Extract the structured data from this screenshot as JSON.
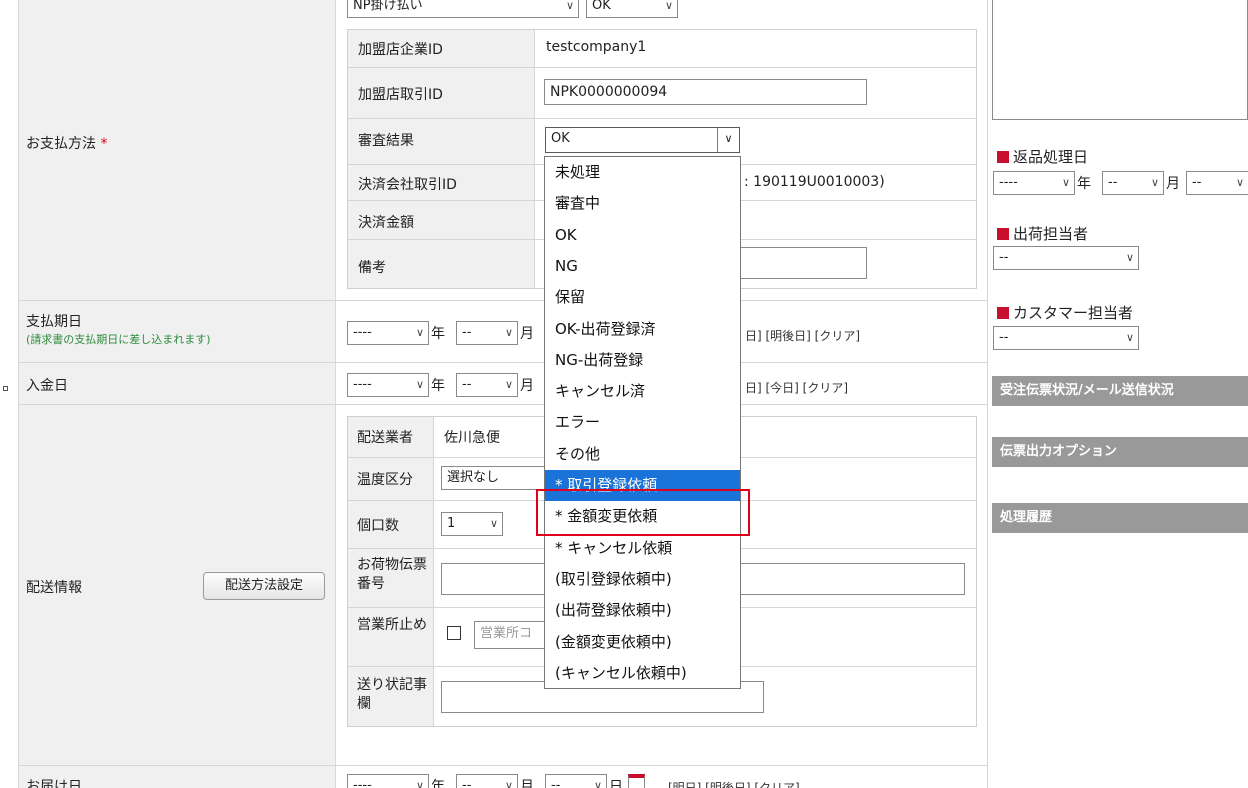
{
  "payment": {
    "label": "お支払方法",
    "required_mark": "*",
    "method_value": "NP掛け払い",
    "status_value": "OK",
    "rows": {
      "merchant_company_id_label": "加盟店企業ID",
      "merchant_company_id_value": "testcompany1",
      "merchant_txn_id_label": "加盟店取引ID",
      "merchant_txn_id_value": "NPK0000000094",
      "review_result_label": "審査結果",
      "review_result_value": "OK",
      "settlement_txn_id_label": "決済会社取引ID",
      "settlement_txn_id_partial": ": 190119U0010003)",
      "settlement_amount_label": "決済金額",
      "notes_label": "備考"
    }
  },
  "dropdown": {
    "options": [
      "未処理",
      "審査中",
      "OK",
      "NG",
      "保留",
      "OK-出荷登録済",
      "NG-出荷登録",
      "キャンセル済",
      "エラー",
      "その他",
      "* 取引登録依頼",
      "* 金額変更依頼",
      "* キャンセル依頼",
      "(取引登録依頼中)",
      "(出荷登録依頼中)",
      "(金額変更依頼中)",
      "(キャンセル依頼中)"
    ],
    "highlighted_index": 10,
    "boxed_index": 11
  },
  "due_date": {
    "label": "支払期日",
    "note": "(請求書の支払期日に差し込まれます)",
    "year": "----",
    "month": "--",
    "year_unit": "年",
    "month_unit": "月",
    "links": "日] [明後日] [クリア]"
  },
  "deposit_date": {
    "label": "入金日",
    "year": "----",
    "month": "--",
    "year_unit": "年",
    "month_unit": "月",
    "links": "日] [今日] [クリア]"
  },
  "shipping": {
    "label": "配送情報",
    "settings_button": "配送方法設定",
    "carrier_label": "配送業者",
    "carrier_value": "佐川急便",
    "temp_label": "温度区分",
    "temp_value": "選択なし",
    "count_label": "個口数",
    "count_value": "1",
    "tracking_label": "お荷物伝票番号",
    "office_hold_label": "営業所止め",
    "office_placeholder": "営業所コ",
    "remarks_label": "送り状記事欄"
  },
  "delivery_date": {
    "label": "お届け日",
    "year": "----",
    "month": "--",
    "day": "--",
    "year_unit": "年",
    "month_unit": "月",
    "day_unit": "日",
    "links": "[明日] [明後日] [クリア]"
  },
  "right_panel": {
    "return_date_label": "返品処理日",
    "return_year": "----",
    "return_month": "--",
    "return_day": "--",
    "year_unit": "年",
    "month_unit": "月",
    "shipper_label": "出荷担当者",
    "shipper_value": "--",
    "cs_label": "カスタマー担当者",
    "cs_value": "--",
    "section_order_status": "受注伝票状況/メール送信状況",
    "section_slip_options": "伝票出力オプション",
    "section_history": "処理履歴"
  },
  "colors": {
    "highlight": "#1a73d9",
    "box": "#e0001b",
    "required": "#e0001b",
    "note_green": "#2e8b3e",
    "section_gray": "#999999"
  }
}
